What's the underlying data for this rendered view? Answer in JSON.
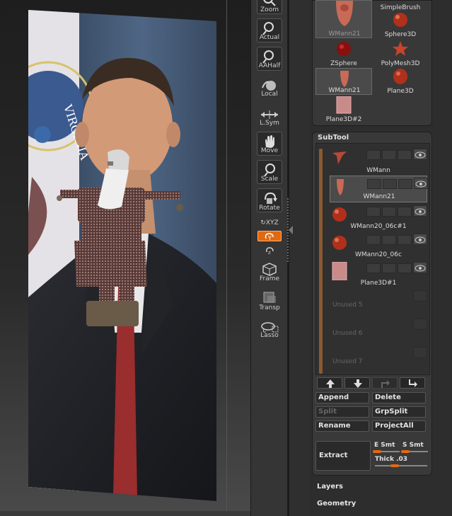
{
  "toolbar": {
    "zoom": "Zoom",
    "actual": "Actual",
    "aahalf": "AAHalf",
    "local": "Local",
    "lsym": "L.Sym",
    "move": "Move",
    "scale": "Scale",
    "rotate": "Rotate",
    "xyz": "XYZ",
    "frame": "Frame",
    "transp": "Transp",
    "lasso": "Lasso"
  },
  "tool_palette": {
    "items": [
      {
        "label": "WMann21",
        "icon": "head-icon",
        "selected": false
      },
      {
        "label": "SimpleBrush",
        "icon": "brush-icon",
        "selected": false
      },
      {
        "label": "Sphere3D",
        "icon": "sphere-icon",
        "selected": false
      },
      {
        "label": "ZSphere",
        "icon": "zsphere-icon",
        "selected": false
      },
      {
        "label": "PolyMesh3D",
        "icon": "star-icon",
        "selected": false
      },
      {
        "label": "WMann21",
        "icon": "head-icon",
        "selected": true
      },
      {
        "label": "Plane3D",
        "icon": "plane-icon",
        "selected": false
      },
      {
        "label": "Plane3D#2",
        "icon": "plane-icon",
        "selected": false
      }
    ]
  },
  "subtool": {
    "title": "SubTool",
    "items": [
      {
        "name": "WMann",
        "icon": "figure-icon"
      },
      {
        "name": "WMann21",
        "icon": "head-icon",
        "selected": true
      },
      {
        "name": "WMann20_06c#1",
        "icon": "sphere-icon"
      },
      {
        "name": "WMann20_06c",
        "icon": "sphere-icon"
      },
      {
        "name": "Plane3D#1",
        "icon": "plane-icon"
      },
      {
        "name": "Unused 5"
      },
      {
        "name": "Unused 6"
      },
      {
        "name": "Unused 7"
      }
    ],
    "buttons": {
      "append": "Append",
      "delete": "Delete",
      "split": "Split",
      "grpsplit": "GrpSplit",
      "rename": "Rename",
      "projectall": "ProjectAll",
      "extract": "Extract"
    },
    "extract_params": {
      "e_smt": "E Smt",
      "s_smt": "S Smt",
      "thick": "Thick .03"
    }
  },
  "menus": {
    "layers": "Layers",
    "geometry": "Geometry"
  },
  "viewport": {
    "seal_text": "VIRGINIA"
  },
  "colors": {
    "accent": "#e06a10",
    "subtool_scroll": "#8a5a30",
    "sphere": "#b0301c",
    "plane": "#c98a8a"
  }
}
